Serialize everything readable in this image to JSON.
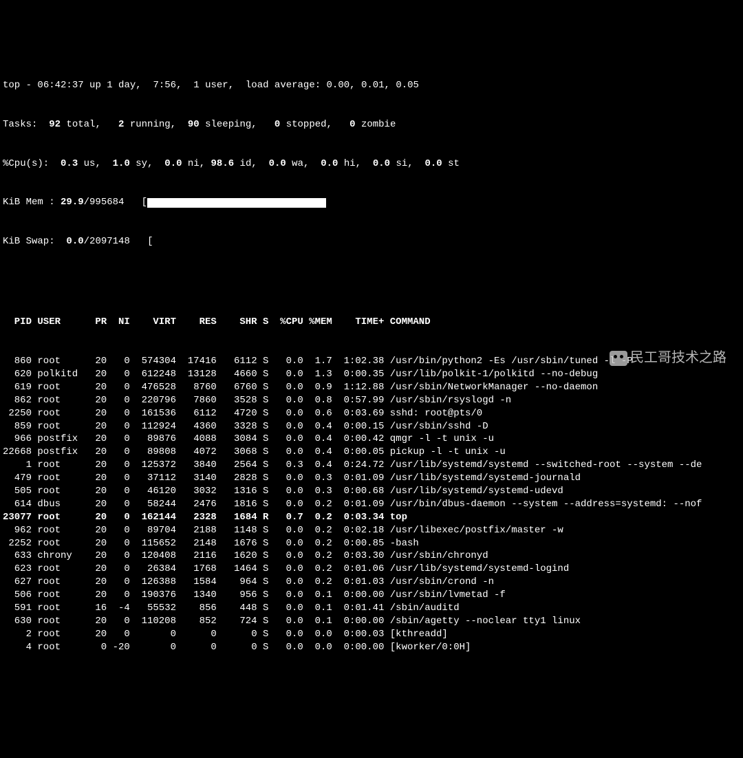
{
  "summary": {
    "top_line": {
      "prefix": "top - ",
      "time": "06:42:37",
      "up": " up 1 day,  7:56,  ",
      "users": "1 user",
      "load_label": ",  load average: ",
      "load": "0.00, 0.01, 0.05"
    },
    "tasks": {
      "prefix": "Tasks:  ",
      "total": "92",
      "total_lbl": " total,   ",
      "running": "2",
      "running_lbl": " running,  ",
      "sleeping": "90",
      "sleeping_lbl": " sleeping,   ",
      "stopped": "0",
      "stopped_lbl": " stopped,   ",
      "zombie": "0",
      "zombie_lbl": " zombie"
    },
    "cpu": {
      "prefix": "%Cpu(s):  ",
      "us": "0.3",
      "us_lbl": " us,  ",
      "sy": "1.0",
      "sy_lbl": " sy,  ",
      "ni": "0.0",
      "ni_lbl": " ni, ",
      "id": "98.6",
      "id_lbl": " id,  ",
      "wa": "0.0",
      "wa_lbl": " wa,  ",
      "hi": "0.0",
      "hi_lbl": " hi,  ",
      "si": "0.0",
      "si_lbl": " si,  ",
      "st": "0.0",
      "st_lbl": " st"
    },
    "mem": {
      "prefix": "KiB Mem : ",
      "free": "29.9",
      "total": "/995684",
      "bracket": "   [",
      "close": ""
    },
    "swap": {
      "prefix": "KiB Swap:  ",
      "free": "0.0",
      "total": "/2097148",
      "bracket": "   [",
      "close": ""
    }
  },
  "columns": [
    "PID",
    "USER",
    "PR",
    "NI",
    "VIRT",
    "RES",
    "SHR",
    "S",
    "%CPU",
    "%MEM",
    "TIME+",
    "COMMAND"
  ],
  "rows": [
    {
      "pid": "860",
      "user": "root",
      "pr": "20",
      "ni": "0",
      "virt": "574304",
      "res": "17416",
      "shr": "6112",
      "s": "S",
      "cpu": "0.0",
      "mem": "1.7",
      "time": "1:02.38",
      "cmd": "/usr/bin/python2 -Es /usr/sbin/tuned -l -P"
    },
    {
      "pid": "620",
      "user": "polkitd",
      "pr": "20",
      "ni": "0",
      "virt": "612248",
      "res": "13128",
      "shr": "4660",
      "s": "S",
      "cpu": "0.0",
      "mem": "1.3",
      "time": "0:00.35",
      "cmd": "/usr/lib/polkit-1/polkitd --no-debug"
    },
    {
      "pid": "619",
      "user": "root",
      "pr": "20",
      "ni": "0",
      "virt": "476528",
      "res": "8760",
      "shr": "6760",
      "s": "S",
      "cpu": "0.0",
      "mem": "0.9",
      "time": "1:12.88",
      "cmd": "/usr/sbin/NetworkManager --no-daemon"
    },
    {
      "pid": "862",
      "user": "root",
      "pr": "20",
      "ni": "0",
      "virt": "220796",
      "res": "7860",
      "shr": "3528",
      "s": "S",
      "cpu": "0.0",
      "mem": "0.8",
      "time": "0:57.99",
      "cmd": "/usr/sbin/rsyslogd -n"
    },
    {
      "pid": "2250",
      "user": "root",
      "pr": "20",
      "ni": "0",
      "virt": "161536",
      "res": "6112",
      "shr": "4720",
      "s": "S",
      "cpu": "0.0",
      "mem": "0.6",
      "time": "0:03.69",
      "cmd": "sshd: root@pts/0"
    },
    {
      "pid": "859",
      "user": "root",
      "pr": "20",
      "ni": "0",
      "virt": "112924",
      "res": "4360",
      "shr": "3328",
      "s": "S",
      "cpu": "0.0",
      "mem": "0.4",
      "time": "0:00.15",
      "cmd": "/usr/sbin/sshd -D"
    },
    {
      "pid": "966",
      "user": "postfix",
      "pr": "20",
      "ni": "0",
      "virt": "89876",
      "res": "4088",
      "shr": "3084",
      "s": "S",
      "cpu": "0.0",
      "mem": "0.4",
      "time": "0:00.42",
      "cmd": "qmgr -l -t unix -u"
    },
    {
      "pid": "22668",
      "user": "postfix",
      "pr": "20",
      "ni": "0",
      "virt": "89808",
      "res": "4072",
      "shr": "3068",
      "s": "S",
      "cpu": "0.0",
      "mem": "0.4",
      "time": "0:00.05",
      "cmd": "pickup -l -t unix -u"
    },
    {
      "pid": "1",
      "user": "root",
      "pr": "20",
      "ni": "0",
      "virt": "125372",
      "res": "3840",
      "shr": "2564",
      "s": "S",
      "cpu": "0.3",
      "mem": "0.4",
      "time": "0:24.72",
      "cmd": "/usr/lib/systemd/systemd --switched-root --system --de"
    },
    {
      "pid": "479",
      "user": "root",
      "pr": "20",
      "ni": "0",
      "virt": "37112",
      "res": "3140",
      "shr": "2828",
      "s": "S",
      "cpu": "0.0",
      "mem": "0.3",
      "time": "0:01.09",
      "cmd": "/usr/lib/systemd/systemd-journald"
    },
    {
      "pid": "505",
      "user": "root",
      "pr": "20",
      "ni": "0",
      "virt": "46120",
      "res": "3032",
      "shr": "1316",
      "s": "S",
      "cpu": "0.0",
      "mem": "0.3",
      "time": "0:00.68",
      "cmd": "/usr/lib/systemd/systemd-udevd"
    },
    {
      "pid": "614",
      "user": "dbus",
      "pr": "20",
      "ni": "0",
      "virt": "58244",
      "res": "2476",
      "shr": "1816",
      "s": "S",
      "cpu": "0.0",
      "mem": "0.2",
      "time": "0:01.09",
      "cmd": "/usr/bin/dbus-daemon --system --address=systemd: --nof"
    },
    {
      "pid": "23077",
      "user": "root",
      "pr": "20",
      "ni": "0",
      "virt": "162144",
      "res": "2328",
      "shr": "1684",
      "s": "R",
      "cpu": "0.7",
      "mem": "0.2",
      "time": "0:03.34",
      "cmd": "top",
      "bold": true
    },
    {
      "pid": "962",
      "user": "root",
      "pr": "20",
      "ni": "0",
      "virt": "89704",
      "res": "2188",
      "shr": "1148",
      "s": "S",
      "cpu": "0.0",
      "mem": "0.2",
      "time": "0:02.18",
      "cmd": "/usr/libexec/postfix/master -w"
    },
    {
      "pid": "2252",
      "user": "root",
      "pr": "20",
      "ni": "0",
      "virt": "115652",
      "res": "2148",
      "shr": "1676",
      "s": "S",
      "cpu": "0.0",
      "mem": "0.2",
      "time": "0:00.85",
      "cmd": "-bash"
    },
    {
      "pid": "633",
      "user": "chrony",
      "pr": "20",
      "ni": "0",
      "virt": "120408",
      "res": "2116",
      "shr": "1620",
      "s": "S",
      "cpu": "0.0",
      "mem": "0.2",
      "time": "0:03.30",
      "cmd": "/usr/sbin/chronyd"
    },
    {
      "pid": "623",
      "user": "root",
      "pr": "20",
      "ni": "0",
      "virt": "26384",
      "res": "1768",
      "shr": "1464",
      "s": "S",
      "cpu": "0.0",
      "mem": "0.2",
      "time": "0:01.06",
      "cmd": "/usr/lib/systemd/systemd-logind"
    },
    {
      "pid": "627",
      "user": "root",
      "pr": "20",
      "ni": "0",
      "virt": "126388",
      "res": "1584",
      "shr": "964",
      "s": "S",
      "cpu": "0.0",
      "mem": "0.2",
      "time": "0:01.03",
      "cmd": "/usr/sbin/crond -n"
    },
    {
      "pid": "506",
      "user": "root",
      "pr": "20",
      "ni": "0",
      "virt": "190376",
      "res": "1340",
      "shr": "956",
      "s": "S",
      "cpu": "0.0",
      "mem": "0.1",
      "time": "0:00.00",
      "cmd": "/usr/sbin/lvmetad -f"
    },
    {
      "pid": "591",
      "user": "root",
      "pr": "16",
      "ni": "-4",
      "virt": "55532",
      "res": "856",
      "shr": "448",
      "s": "S",
      "cpu": "0.0",
      "mem": "0.1",
      "time": "0:01.41",
      "cmd": "/sbin/auditd"
    },
    {
      "pid": "630",
      "user": "root",
      "pr": "20",
      "ni": "0",
      "virt": "110208",
      "res": "852",
      "shr": "724",
      "s": "S",
      "cpu": "0.0",
      "mem": "0.1",
      "time": "0:00.00",
      "cmd": "/sbin/agetty --noclear tty1 linux"
    },
    {
      "pid": "2",
      "user": "root",
      "pr": "20",
      "ni": "0",
      "virt": "0",
      "res": "0",
      "shr": "0",
      "s": "S",
      "cpu": "0.0",
      "mem": "0.0",
      "time": "0:00.03",
      "cmd": "[kthreadd]"
    },
    {
      "pid": "4",
      "user": "root",
      "pr": "0",
      "ni": "-20",
      "virt": "0",
      "res": "0",
      "shr": "0",
      "s": "S",
      "cpu": "0.0",
      "mem": "0.0",
      "time": "0:00.00",
      "cmd": "[kworker/0:0H]"
    }
  ],
  "watermark": "民工哥技术之路"
}
